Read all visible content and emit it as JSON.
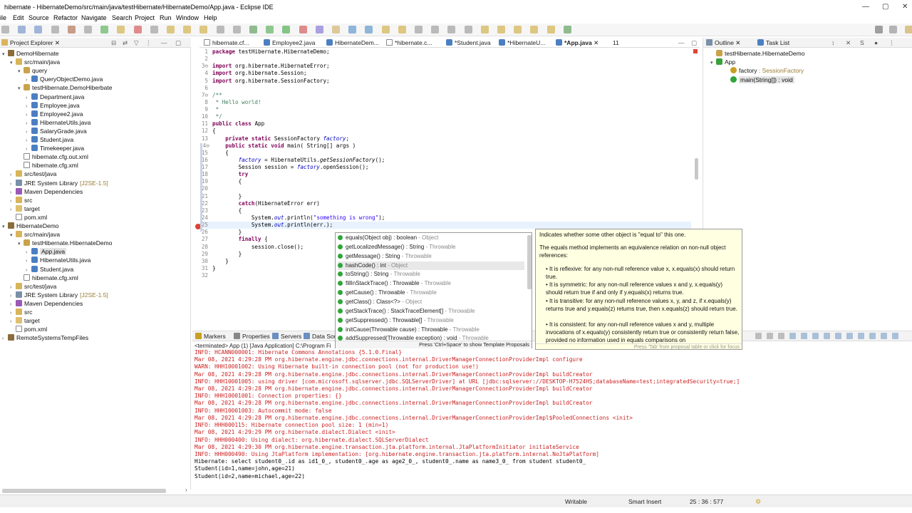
{
  "window": {
    "title": "hibernate - HibernateDemo/src/main/java/testHibernate/HibernateDemo/App.java - Eclipse IDE"
  },
  "menu": [
    "ile",
    "Edit",
    "Source",
    "Refactor",
    "Navigate",
    "Search",
    "Project",
    "Run",
    "Window",
    "Help"
  ],
  "explorer": {
    "tab_label": "Project Explorer",
    "rows": [
      {
        "label": "DemoHibernate",
        "depth": 0,
        "icon": "proj",
        "tri": "▾"
      },
      {
        "label": "src/main/java",
        "depth": 1,
        "icon": "folder",
        "tri": "▾"
      },
      {
        "label": "query",
        "depth": 2,
        "icon": "pkg",
        "tri": "▾"
      },
      {
        "label": "QueryObjectDemo.java",
        "depth": 3,
        "icon": "java",
        "tri": "›"
      },
      {
        "label": "testHibernate.DemoHiberbate",
        "depth": 2,
        "icon": "pkg",
        "tri": "▾"
      },
      {
        "label": "Department.java",
        "depth": 3,
        "icon": "java",
        "tri": "›"
      },
      {
        "label": "Employee.java",
        "depth": 3,
        "icon": "java",
        "tri": "›"
      },
      {
        "label": "Employee2.java",
        "depth": 3,
        "icon": "java",
        "tri": "›"
      },
      {
        "label": "HibernateUtils.java",
        "depth": 3,
        "icon": "java",
        "tri": "›"
      },
      {
        "label": "SalaryGrade.java",
        "depth": 3,
        "icon": "java",
        "tri": "›"
      },
      {
        "label": "Student.java",
        "depth": 3,
        "icon": "java",
        "tri": "›"
      },
      {
        "label": "Timekeeper.java",
        "depth": 3,
        "icon": "java",
        "tri": "›"
      },
      {
        "label": "hibernate.cfg.out.xml",
        "depth": 2,
        "icon": "xml",
        "tri": ""
      },
      {
        "label": "hibernate.cfg.xml",
        "depth": 2,
        "icon": "xml",
        "tri": ""
      },
      {
        "label": "src/test/java",
        "depth": 1,
        "icon": "folder",
        "tri": "›"
      },
      {
        "label": "JRE System Library",
        "suffix": "[J2SE-1.5]",
        "depth": 1,
        "icon": "lib",
        "tri": "›"
      },
      {
        "label": "Maven Dependencies",
        "depth": 1,
        "icon": "maven",
        "tri": "›"
      },
      {
        "label": "src",
        "depth": 1,
        "icon": "folder",
        "tri": "›"
      },
      {
        "label": "target",
        "depth": 1,
        "icon": "target",
        "tri": "›"
      },
      {
        "label": "pom.xml",
        "depth": 1,
        "icon": "xml",
        "tri": ""
      },
      {
        "label": "HibernateDemo",
        "depth": 0,
        "icon": "proj",
        "tri": "▾"
      },
      {
        "label": "src/main/java",
        "depth": 1,
        "icon": "folder",
        "tri": "▾"
      },
      {
        "label": "testHibernate.HibernateDemo",
        "depth": 2,
        "icon": "pkg",
        "tri": "▾"
      },
      {
        "label": "App.java",
        "depth": 3,
        "icon": "java",
        "tri": "›",
        "selected": true
      },
      {
        "label": "HibernateUtils.java",
        "depth": 3,
        "icon": "java",
        "tri": "›"
      },
      {
        "label": "Student.java",
        "depth": 3,
        "icon": "java",
        "tri": "›"
      },
      {
        "label": "hibernate.cfg.xml",
        "depth": 2,
        "icon": "xml",
        "tri": ""
      },
      {
        "label": "src/test/java",
        "depth": 1,
        "icon": "folder",
        "tri": "›"
      },
      {
        "label": "JRE System Library",
        "suffix": "[J2SE-1.5]",
        "depth": 1,
        "icon": "lib",
        "tri": "›"
      },
      {
        "label": "Maven Dependencies",
        "depth": 1,
        "icon": "maven",
        "tri": "›"
      },
      {
        "label": "src",
        "depth": 1,
        "icon": "folder",
        "tri": "›"
      },
      {
        "label": "target",
        "depth": 1,
        "icon": "target",
        "tri": "›"
      },
      {
        "label": "pom.xml",
        "depth": 1,
        "icon": "xml",
        "tri": ""
      },
      {
        "label": "RemoteSystemsTempFiles",
        "depth": 0,
        "icon": "proj",
        "tri": "›"
      }
    ]
  },
  "editor_tabs": [
    "hibernate.cf...",
    "Employee2.java",
    "HibernateDem...",
    "*hibernate.c...",
    "*Student.java",
    "*HibernateU...",
    "*App.java",
    "11"
  ],
  "code": [
    {
      "n": "1",
      "html": "<span class='kw'>package</span> testHibernate.HibernateDemo;"
    },
    {
      "n": "2",
      "html": ""
    },
    {
      "n": "3⊖",
      "html": "<span class='kw'>import</span> org.hibernate.HibernateError;"
    },
    {
      "n": "4",
      "html": "<span class='kw'>import</span> org.hibernate.Session;"
    },
    {
      "n": "5",
      "html": "<span class='kw'>import</span> org.hibernate.SessionFactory;"
    },
    {
      "n": "6",
      "html": ""
    },
    {
      "n": "7⊖",
      "html": "<span class='cm'>/**</span>"
    },
    {
      "n": "8",
      "html": "<span class='cm'> * Hello world!</span>"
    },
    {
      "n": "9",
      "html": "<span class='cm'> *</span>"
    },
    {
      "n": "10",
      "html": "<span class='cm'> */</span>"
    },
    {
      "n": "11",
      "html": "<span class='kw'>public class</span> App"
    },
    {
      "n": "12",
      "html": "{"
    },
    {
      "n": "13",
      "html": "    <span class='kw'>private static</span> SessionFactory <span class='fd'>factory</span>;"
    },
    {
      "n": "14⊖",
      "html": "    <span class='kw'>public static void</span> main( String[] args )"
    },
    {
      "n": "15",
      "html": "    {"
    },
    {
      "n": "16",
      "html": "        <span class='fd'>factory</span> = HibernateUtils.<span class='it'>getSessionFactory</span>();"
    },
    {
      "n": "17",
      "html": "        Session session = <span class='fd'>factory</span>.openSession();"
    },
    {
      "n": "18",
      "html": "        <span class='kw'>try</span>"
    },
    {
      "n": "19",
      "html": "        {"
    },
    {
      "n": "20",
      "html": ""
    },
    {
      "n": "21",
      "html": "        }"
    },
    {
      "n": "22",
      "html": "        <span class='kw'>catch</span>(HibernateError err)"
    },
    {
      "n": "23",
      "html": "        {"
    },
    {
      "n": "24",
      "html": "            System.<span class='fd'>out</span>.println(<span class='st'>\"something is wrong\"</span>);"
    },
    {
      "n": "25",
      "html": "            System.<span class='fd'>out</span>.println(err.);"
    },
    {
      "n": "26",
      "html": "        }"
    },
    {
      "n": "27",
      "html": "        <span class='kw'>finally</span> {"
    },
    {
      "n": "28",
      "html": "            session.close();"
    },
    {
      "n": "29",
      "html": "        }"
    },
    {
      "n": "30",
      "html": "    }"
    },
    {
      "n": "31",
      "html": "}"
    },
    {
      "n": "32",
      "html": ""
    }
  ],
  "proposals": [
    {
      "name": "equals(Object obj) : boolean",
      "type": "Object"
    },
    {
      "name": "getLocalizedMessage() : String",
      "type": "Throwable"
    },
    {
      "name": "getMessage() : String",
      "type": "Throwable"
    },
    {
      "name": "hashCode() : int",
      "type": "Object",
      "selected": true
    },
    {
      "name": "toString() : String",
      "type": "Throwable"
    },
    {
      "name": "fillInStackTrace() : Throwable",
      "type": "Throwable"
    },
    {
      "name": "getCause() : Throwable",
      "type": "Throwable"
    },
    {
      "name": "getClass() : Class<?>",
      "type": "Object"
    },
    {
      "name": "getStackTrace() : StackTraceElement[]",
      "type": "Throwable"
    },
    {
      "name": "getSuppressed() : Throwable[]",
      "type": "Throwable"
    },
    {
      "name": "initCause(Throwable cause) : Throwable",
      "type": "Throwable"
    },
    {
      "name": "addSuppressed(Throwable exception) : void",
      "type": "Throwable"
    }
  ],
  "proposal_hint": "Press 'Ctrl+Space' to show Template Proposals",
  "doc": {
    "summary": "Indicates whether some other object is \"equal to\" this one.",
    "para": "The equals method implements an equivalence relation on non-null object references:",
    "b1": "It is reflexive: for any non-null reference value x, x.equals(x) should return true.",
    "b2": "It is symmetric: for any non-null reference values x and y, x.equals(y) should return true if and only if y.equals(x) returns true.",
    "b3": "It is transitive: for any non-null reference values x, y, and z, if x.equals(y) returns true and y.equals(z) returns true, then x.equals(z) should return true.",
    "b4": "It is consistent: for any non-null reference values x and y, multiple invocations of x.equals(y) consistently return true or consistently return false, provided no information used in equals comparisons on",
    "footer": "Press 'Tab' from proposal table or click for focus"
  },
  "outline": {
    "tab_label": "Outline",
    "task_label": "Task List",
    "rows": [
      {
        "label": "testHibernate.HibernateDemo",
        "depth": 0
      },
      {
        "label": "App",
        "depth": 0,
        "tri": "▾"
      },
      {
        "label": "factory",
        "suffix": " : SessionFactory",
        "depth": 1
      },
      {
        "label": "main(String[]) : void",
        "depth": 1,
        "selected": true
      }
    ]
  },
  "bottom_tabs": [
    "Markers",
    "Properties",
    "Servers",
    "Data Sou"
  ],
  "console_header": "<terminated> App (1) [Java Application] C:\\Program Fi",
  "console": [
    {
      "c": "red",
      "t": "INFO: HCANN000001: Hibernate Commons Annotations {5.1.0.Final}"
    },
    {
      "c": "red",
      "t": "Mar 08, 2021 4:29:28 PM org.hibernate.engine.jdbc.connections.internal.DriverManagerConnectionProviderImpl configure"
    },
    {
      "c": "red",
      "t": "WARN: HHH10001002: Using Hibernate built-in connection pool (not for production use!)"
    },
    {
      "c": "red",
      "t": "Mar 08, 2021 4:29:28 PM org.hibernate.engine.jdbc.connections.internal.DriverManagerConnectionProviderImpl buildCreator"
    },
    {
      "c": "red",
      "t": "INFO: HHH10001005: using driver [com.microsoft.sqlserver.jdbc.SQLServerDriver] at URL [jdbc:sqlserver://DESKTOP-H7524HS;databaseName=test;integratedSecurity=true;]"
    },
    {
      "c": "red",
      "t": "Mar 08, 2021 4:29:28 PM org.hibernate.engine.jdbc.connections.internal.DriverManagerConnectionProviderImpl buildCreator"
    },
    {
      "c": "red",
      "t": "INFO: HHH10001001: Connection properties: {}"
    },
    {
      "c": "red",
      "t": "Mar 08, 2021 4:29:28 PM org.hibernate.engine.jdbc.connections.internal.DriverManagerConnectionProviderImpl buildCreator"
    },
    {
      "c": "red",
      "t": "INFO: HHH10001003: Autocommit mode: false"
    },
    {
      "c": "red",
      "t": "Mar 08, 2021 4:29:28 PM org.hibernate.engine.jdbc.connections.internal.DriverManagerConnectionProviderImpl$PooledConnections <init>"
    },
    {
      "c": "red",
      "t": "INFO: HHH000115: Hibernate connection pool size: 1 (min=1)"
    },
    {
      "c": "red",
      "t": "Mar 08, 2021 4:29:29 PM org.hibernate.dialect.Dialect <init>"
    },
    {
      "c": "red",
      "t": "INFO: HHH000400: Using dialect: org.hibernate.dialect.SQLServerDialect"
    },
    {
      "c": "red",
      "t": "Mar 08, 2021 4:29:30 PM org.hibernate.engine.transaction.jta.platform.internal.JtaPlatformInitiator initiateService"
    },
    {
      "c": "red",
      "t": "INFO: HHH000490: Using JtaPlatform implementation: [org.hibernate.engine.transaction.jta.platform.internal.NoJtaPlatform]"
    },
    {
      "c": "blk",
      "t": "Hibernate: select student0_.id as id1_0_, student0_.age as age2_0_, student0_.name as name3_0_ from student student0_"
    },
    {
      "c": "blk",
      "t": "Student(id=1,name=john,age=21)"
    },
    {
      "c": "blk",
      "t": "Student(id=2,name=michael,age=22)"
    }
  ],
  "status": {
    "writable": "Writable",
    "insert": "Smart Insert",
    "position": "25 : 36 : 577"
  }
}
